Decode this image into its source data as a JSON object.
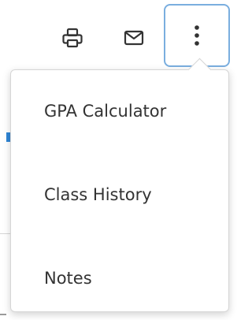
{
  "toolbar": {
    "print_icon": "printer-icon",
    "mail_icon": "envelope-icon",
    "more_icon": "vertical-ellipsis-icon"
  },
  "menu": {
    "items": [
      {
        "label": "GPA Calculator"
      },
      {
        "label": "Class History"
      },
      {
        "label": "Notes"
      }
    ]
  },
  "colors": {
    "accent": "#7aaedf",
    "icon": "#333333",
    "menu_border": "#d6d6d6",
    "text": "#333333",
    "page_accent": "#2f86d6"
  }
}
